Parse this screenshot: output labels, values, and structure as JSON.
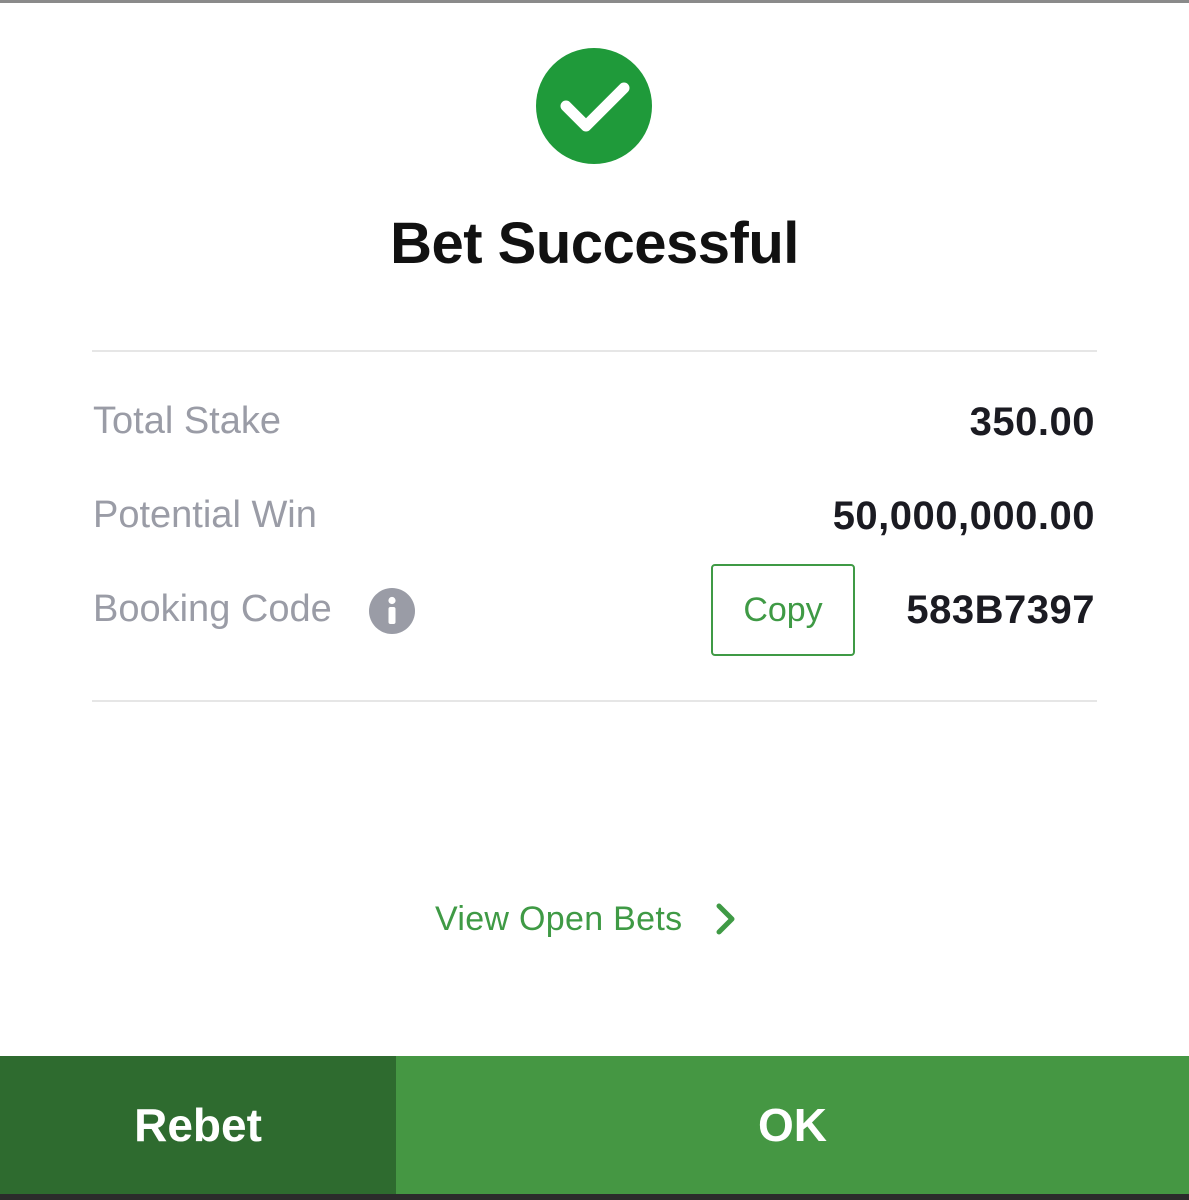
{
  "dialog": {
    "title": "Bet Successful",
    "icon": "check-circle-icon",
    "accent_color": "#1f9a3a"
  },
  "summary": {
    "total_stake_label": "Total Stake",
    "total_stake_value": "350.00",
    "potential_win_label": "Potential Win",
    "potential_win_value": "50,000,000.00",
    "booking_code_label": "Booking Code",
    "booking_code_info_icon": "info-icon",
    "copy_label": "Copy",
    "booking_code_value": "583B7397"
  },
  "links": {
    "view_open_bets": "View Open Bets"
  },
  "actions": {
    "rebet_label": "Rebet",
    "ok_label": "OK",
    "rebet_color": "#2e6b2f",
    "ok_color": "#459743"
  }
}
